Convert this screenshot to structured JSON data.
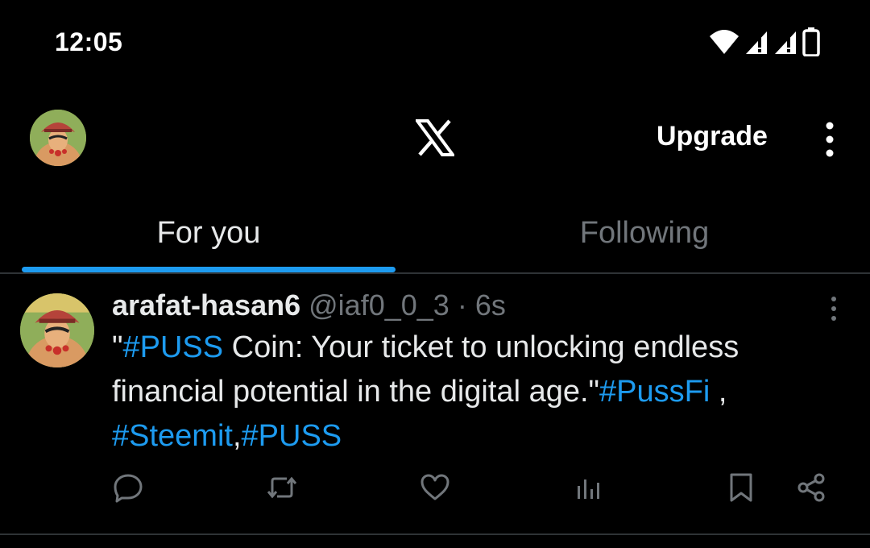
{
  "status_bar": {
    "time": "12:05",
    "icons": [
      "wifi-icon",
      "cell-signal-icon",
      "cell-signal-icon",
      "battery-icon"
    ]
  },
  "top_bar": {
    "avatar_icon": "profile-avatar",
    "logo_icon": "x-logo-icon",
    "upgrade_label": "Upgrade",
    "menu_icon": "more-vertical-icon"
  },
  "tabs": [
    {
      "label": "For you",
      "selected": true
    },
    {
      "label": "Following",
      "selected": false
    }
  ],
  "tweet": {
    "author_name": "arafat-hasan6",
    "handle": "@iaf0_0_3",
    "separator": "·",
    "time": "6s",
    "text": {
      "quote_open": "\"",
      "tag1": "#PUSS",
      "part1": " Coin: Your ticket to unlocking endless financial potential in the digital age.\"",
      "tag2": "#PussFi",
      "part2": " , ",
      "tag3": "#Steemit",
      "part3": ",",
      "tag4": "#PUSS"
    },
    "actions": [
      "reply-icon",
      "retweet-icon",
      "like-icon",
      "views-icon",
      "bookmark-icon",
      "share-icon"
    ]
  },
  "colors": {
    "background": "#000000",
    "accent": "#1d9bf0",
    "text_primary": "#e7e9ea",
    "text_secondary": "#71767b",
    "divider": "#2f3336"
  }
}
